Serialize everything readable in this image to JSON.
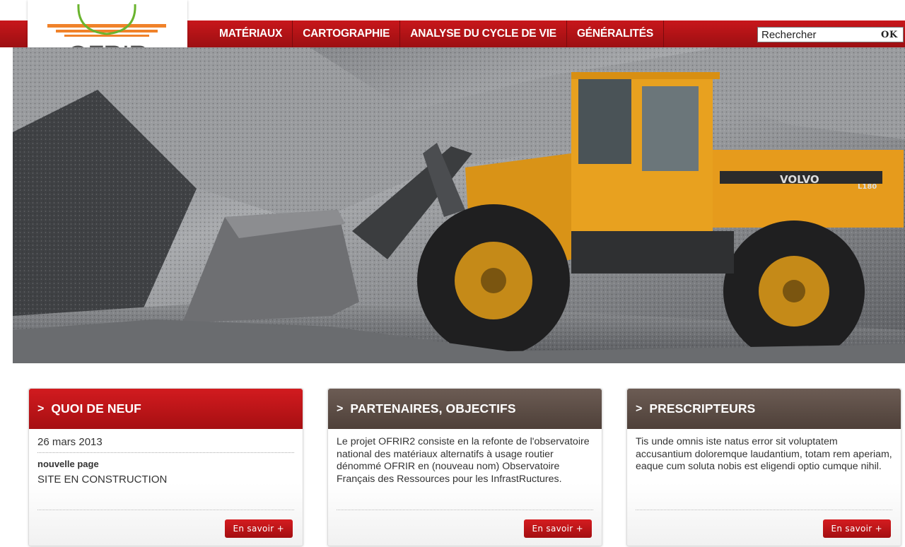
{
  "logo": {
    "text": "OFRIR"
  },
  "nav": {
    "items": [
      {
        "label": "MATÉRIAUX"
      },
      {
        "label": "CARTOGRAPHIE"
      },
      {
        "label": "ANALYSE DU CYCLE DE VIE"
      },
      {
        "label": "GÉNÉRALITÉS"
      }
    ],
    "search_placeholder": "Rechercher",
    "search_button": "OK"
  },
  "hero": {
    "icon": "wheel-loader-illustration",
    "machine_brand": "VOLVO",
    "machine_model": "L180"
  },
  "cards": [
    {
      "title": "QUOI DE NEUF",
      "date": "26 mars 2013",
      "news_title": "nouvelle page",
      "news_text": "SITE EN CONSTRUCTION",
      "button": "En savoir +"
    },
    {
      "title": "PARTENAIRES, OBJECTIFS",
      "text": "Le projet OFRIR2 consiste en la refonte de l'observatoire national des matériaux alternatifs à usage routier dénommé OFRIR en (nouveau nom) Observatoire Français des Ressources pour les InfrastRuctures.",
      "button": "En savoir +"
    },
    {
      "title": "PRESCRIPTEURS",
      "text": "Tis unde omnis iste natus error sit voluptatem accusantium doloremque laudantium, totam rem aperiam, eaque cum soluta nobis est eligendi optio cumque nihil.",
      "button": "En savoir +"
    }
  ],
  "colors": {
    "brand_red": "#b51418",
    "card_brown": "#5d4e47",
    "logo_orange": "#f0822a",
    "logo_green": "#6ab42e"
  }
}
